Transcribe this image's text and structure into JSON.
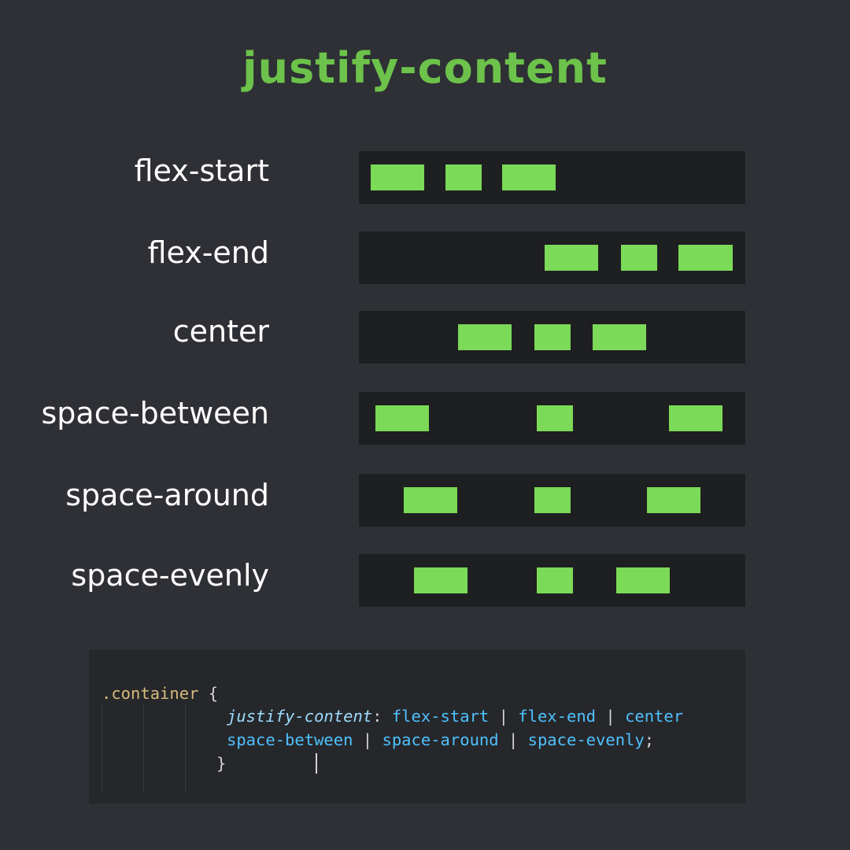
{
  "title": "justify-content",
  "rows": [
    {
      "label": "flex-start",
      "justify": "flex-start"
    },
    {
      "label": "flex-end",
      "justify": "flex-end"
    },
    {
      "label": "center",
      "justify": "center"
    },
    {
      "label": "space-between",
      "justify": "space-between"
    },
    {
      "label": "space-around",
      "justify": "space-around"
    },
    {
      "label": "space-evenly",
      "justify": "space-evenly"
    }
  ],
  "code": {
    "selector": ".container",
    "open_brace": "{",
    "property": "justify-content",
    "colon": ":",
    "values_line1": [
      "flex-start",
      "flex-end",
      "center"
    ],
    "values_line2": [
      "space-between",
      "space-around",
      "space-evenly"
    ],
    "separator": "|",
    "semicolon": ";",
    "close_brace": "}"
  },
  "colors": {
    "background": "#2e3035",
    "title": "#6cc24a",
    "bar": "#1e1f21",
    "box": "#7bda57",
    "code_background": "#26272a"
  }
}
